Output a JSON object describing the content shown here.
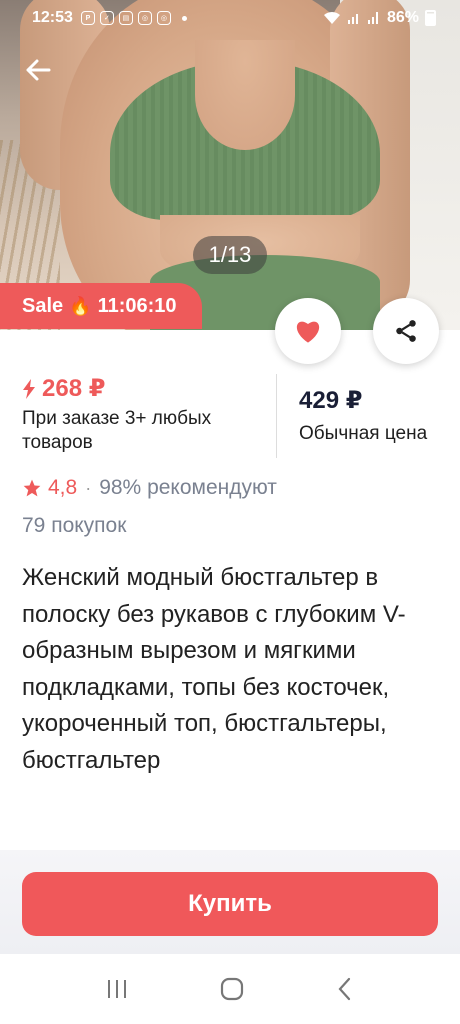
{
  "status_bar": {
    "time": "12:53",
    "battery": "86%",
    "notification_icons": [
      "pay-icon",
      "check-icon",
      "news-icon",
      "instagram-icon",
      "instagram-icon"
    ]
  },
  "gallery": {
    "counter": "1/13"
  },
  "sale": {
    "label": "Sale",
    "timer": "11:06:10"
  },
  "pricing": {
    "deal_price": "268 ₽",
    "deal_note": "При заказе 3+ любых товаров",
    "regular_price": "429 ₽",
    "regular_note": "Обычная цена"
  },
  "rating": {
    "value": "4,8",
    "separator": "·",
    "recommend": "98% рекомендуют",
    "purchases": "79 покупок"
  },
  "product": {
    "title": "Женский модный бюстгальтер в полоску без рукавов с глубоким V-образным вырезом и мягкими подкладками, топы без косточек, укороченный топ, бюстгальтеры, бюстгальтер"
  },
  "actions": {
    "buy_label": "Купить"
  },
  "colors": {
    "accent": "#ee5a5a",
    "buy_button": "#f0585a",
    "muted_text": "#7a8190"
  }
}
